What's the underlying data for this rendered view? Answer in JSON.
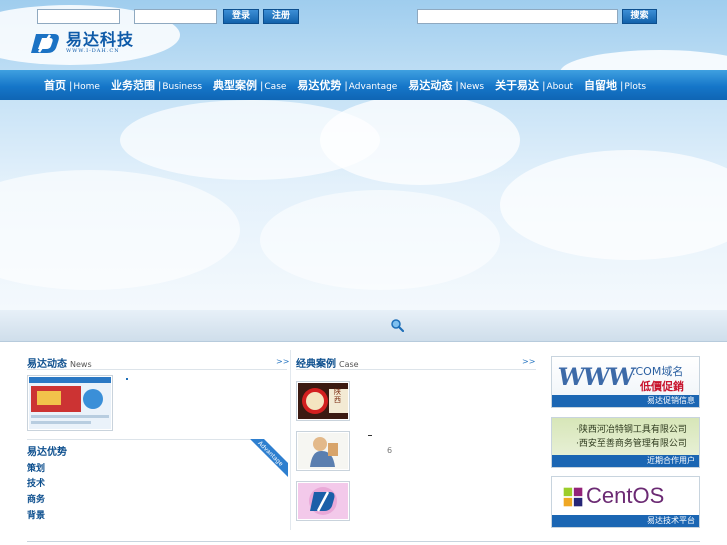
{
  "logo": {
    "name_cn": "易达科技",
    "name_en": "WWW.I-DAH.CN"
  },
  "nav": [
    {
      "cn": "首页",
      "en": "Home"
    },
    {
      "cn": "业务范围",
      "en": "Business"
    },
    {
      "cn": "典型案例",
      "en": "Case"
    },
    {
      "cn": "易达优势",
      "en": "Advantage"
    },
    {
      "cn": "易达动态",
      "en": "News"
    },
    {
      "cn": "关于易达",
      "en": "About"
    },
    {
      "cn": "自留地",
      "en": "Plots"
    }
  ],
  "login": {
    "username_value": "",
    "password_value": "",
    "login_label": "登录",
    "register_label": "注册"
  },
  "search": {
    "value": "",
    "button_label": "搜索"
  },
  "news": {
    "title_cn": "易达动态",
    "title_en": "News",
    "more": ">>"
  },
  "cases": {
    "title_cn": "经典案例",
    "title_en": "Case",
    "more": ">>",
    "badge_text": "陕西",
    "case_2_note": "6"
  },
  "advantage": {
    "title_cn": "易达优势",
    "tab_text": "Advantage",
    "items": [
      "策划",
      "技术",
      "商务",
      "背景"
    ]
  },
  "side_ads": [
    {
      "headline_1": ".COM域名",
      "headline_2": "低價促銷",
      "www": "WWW",
      "caption": "易达促销信息"
    },
    {
      "line_1": "·陕西河冶特钢工具有限公司",
      "line_2": "·西安至善商务管理有限公司",
      "caption": "近期合作用户"
    },
    {
      "brand": "CentOS",
      "caption": "易达技术平台"
    }
  ],
  "colors": {
    "nav": "#1576c9",
    "brand": "#0e5aa8",
    "caption": "#1b66b3"
  }
}
